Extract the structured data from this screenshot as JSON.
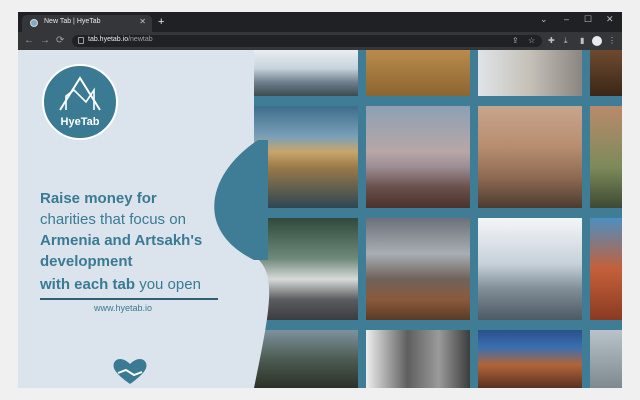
{
  "browser": {
    "tab_title": "New Tab | HyeTab",
    "tab_close": "✕",
    "new_tab": "+",
    "window_controls": {
      "chevron": "⌄",
      "minimize": "–",
      "maximize": "☐",
      "close": "✕"
    },
    "nav": {
      "back": "←",
      "forward": "→",
      "reload": "⟳"
    },
    "url_host": "tab.hyetab.io",
    "url_path": "/newtab",
    "toolbar_icons": [
      "share-icon",
      "star-icon",
      "download-icon",
      "extensions-icon",
      "sidepanel-icon",
      "profile-icon",
      "menu-icon"
    ],
    "toolbar_glyphs": {
      "share": "⇪",
      "star": "☆",
      "download": "⤓",
      "extensions": "✚",
      "sidepanel": "▮",
      "menu": "⋮"
    }
  },
  "hero": {
    "logo_text": "HyeTab",
    "line1": "Raise money for",
    "line2": "charities that focus on",
    "line3": "Armenia and Artsakh's",
    "line4": "development",
    "line5_bold": "with each tab",
    "line5_light": " you open",
    "website": "www.hyetab.io"
  },
  "gallery": {
    "photos": [
      "mountain-landscape",
      "wheat-field",
      "stone-building",
      "arched-door",
      "museum-reflection",
      "ararat-dusk",
      "fountain-square",
      "building-trees",
      "vintage-car-flag",
      "ararat-snow",
      "church-clouds",
      "red-sculpture",
      "government-building",
      "stone-faces",
      "yerevan-night",
      "cloud-landscape"
    ]
  },
  "colors": {
    "brand_blue": "#3a7a93",
    "panel_bg": "#dbe4ec",
    "grid_bg": "#3f7d96"
  }
}
